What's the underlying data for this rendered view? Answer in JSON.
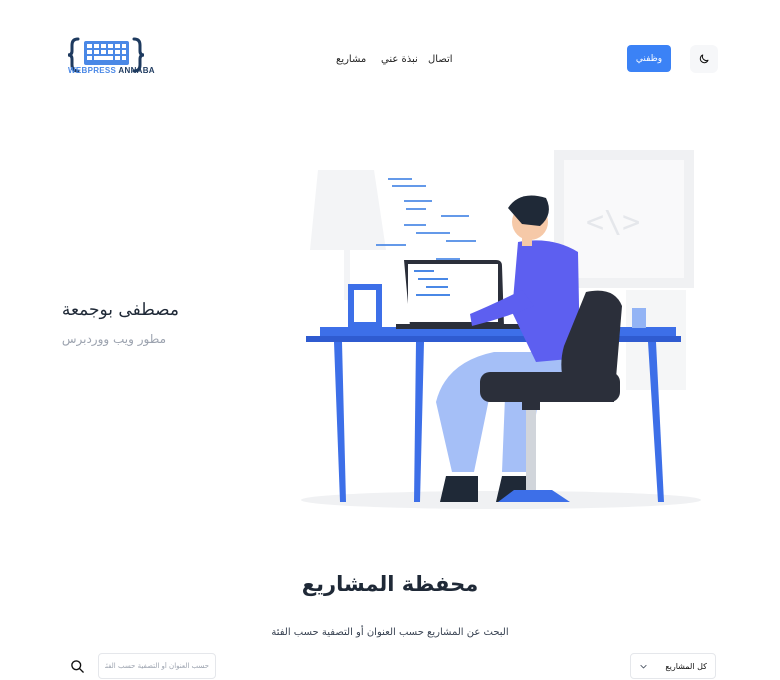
{
  "header": {
    "logo_icon": "keyboard-braces-logo",
    "logo_text_a": "WEBPRESS",
    "logo_text_b": " ANNABA",
    "nav": {
      "projects": "مشاريع",
      "about": "نبذة عني",
      "contact": "اتصال"
    },
    "cv_button": "وظفني",
    "theme_icon": "moon-icon"
  },
  "hero": {
    "name": "مصطفى بوجمعة",
    "role": "مطور ويب ووردبرس",
    "illustration": "developer-at-desk-illustration"
  },
  "portfolio": {
    "title": "محفظة المشاريع",
    "subtitle": "البحث عن المشاريع حسب العنوان أو التصفية حسب الفئة",
    "search_placeholder": "حسب العنوان أو التصفية حسب الفئة",
    "search_icon": "search-icon",
    "category_selected": "كل المشاريع"
  },
  "colors": {
    "accent": "#3b82f6",
    "logo_blue": "#4a88e6",
    "logo_dark": "#1e3a5f",
    "illustration_blue": "#3d6fe8",
    "illustration_purple": "#5d5ff0"
  }
}
